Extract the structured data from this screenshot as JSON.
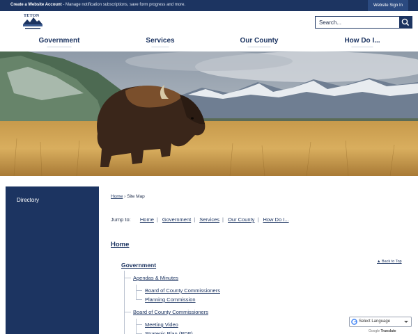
{
  "topbar": {
    "account_title": "Create a Website Account",
    "account_desc": " - Manage notification subscriptions, save form progress and more.",
    "sign_in": "Website Sign In"
  },
  "header": {
    "logo_text": "TETON",
    "search_placeholder": "Search...",
    "search_icon": "search-icon"
  },
  "nav": {
    "items": [
      {
        "label": "Government"
      },
      {
        "label": "Services"
      },
      {
        "label": "Our County"
      },
      {
        "label": "How Do I..."
      }
    ]
  },
  "hero": {
    "image": "bison-in-grassland-with-snowy-mountains"
  },
  "sidebar": {
    "directory_label": "Directory"
  },
  "breadcrumb": {
    "home": "Home",
    "separator": "›",
    "current": "Site Map"
  },
  "jump": {
    "label": "Jump to:",
    "links": [
      "Home",
      "Government",
      "Services",
      "Our County",
      "How Do I..."
    ],
    "separator": "|"
  },
  "sitemap": {
    "home": "Home",
    "government": "Government",
    "back_to_top": "▲ Back to Top",
    "agendas": "Agendas & Minutes",
    "agendas_children": [
      "Board of County Commissioners",
      "Planning Commission"
    ],
    "board": "Board of County Commissioners",
    "board_children": [
      "Meeting Video",
      "Strategic Plan (PDF)"
    ]
  },
  "translate": {
    "select_label": "Select Language",
    "powered_by": "Google",
    "translate_word": "Translate"
  },
  "colors": {
    "navy": "#1c3461",
    "link": "#1c3461",
    "white": "#ffffff"
  }
}
